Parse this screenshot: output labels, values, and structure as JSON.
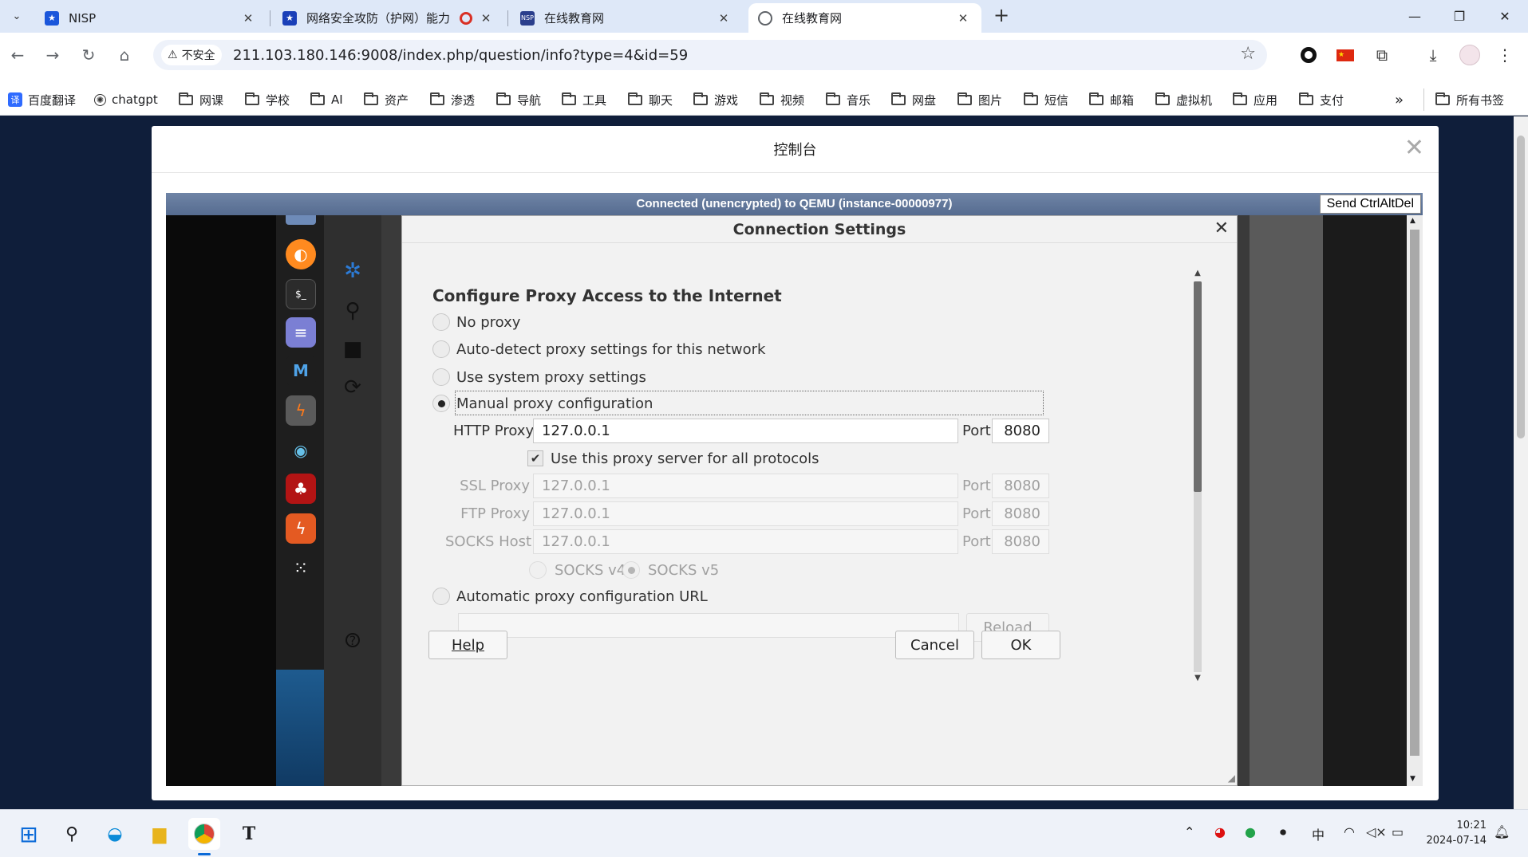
{
  "browser": {
    "tabs": [
      {
        "label": "NISP",
        "favicon_color": "#1a56db",
        "active": false
      },
      {
        "label": "网络安全攻防（护网）能力",
        "favicon_color": "#1a3fb8",
        "active": false
      },
      {
        "label": "在线教育网",
        "favicon_color": "#2a3e8c",
        "active": false
      },
      {
        "label": "在线教育网",
        "favicon_color": "#5f6368",
        "active": true
      }
    ],
    "address": {
      "security_label": "不安全",
      "url": "211.103.180.146:9008/index.php/question/info?type=4&id=59"
    },
    "bookmarks": [
      {
        "label": "百度翻译",
        "type": "link"
      },
      {
        "label": "chatgpt",
        "type": "link"
      },
      {
        "label": "网课",
        "type": "folder"
      },
      {
        "label": "学校",
        "type": "folder"
      },
      {
        "label": "AI",
        "type": "folder"
      },
      {
        "label": "资产",
        "type": "folder"
      },
      {
        "label": "渗透",
        "type": "folder"
      },
      {
        "label": "导航",
        "type": "folder"
      },
      {
        "label": "工具",
        "type": "folder"
      },
      {
        "label": "聊天",
        "type": "folder"
      },
      {
        "label": "游戏",
        "type": "folder"
      },
      {
        "label": "视频",
        "type": "folder"
      },
      {
        "label": "音乐",
        "type": "folder"
      },
      {
        "label": "网盘",
        "type": "folder"
      },
      {
        "label": "图片",
        "type": "folder"
      },
      {
        "label": "短信",
        "type": "folder"
      },
      {
        "label": "邮箱",
        "type": "folder"
      },
      {
        "label": "虚拟机",
        "type": "folder"
      },
      {
        "label": "应用",
        "type": "folder"
      },
      {
        "label": "支付",
        "type": "folder"
      }
    ],
    "bookmarks_overflow": "»",
    "all_bookmarks": "所有书签"
  },
  "console": {
    "title": "控制台",
    "vnc_status": "Connected (unencrypted) to QEMU (instance-00000977)",
    "cad_button": "Send CtrlAltDel"
  },
  "dialog": {
    "title": "Connection Settings",
    "heading": "Configure Proxy Access to the Internet",
    "options": {
      "no_proxy": "No proxy",
      "auto_detect": "Auto-detect proxy settings for this network",
      "system": "Use system proxy settings",
      "manual": "Manual proxy configuration",
      "auto_url": "Automatic proxy configuration URL"
    },
    "selected_option": "manual",
    "http_proxy": {
      "label": "HTTP Proxy",
      "value": "127.0.0.1",
      "port_label": "Port",
      "port": "8080"
    },
    "use_for_all": {
      "label": "Use this proxy server for all protocols",
      "checked": true
    },
    "ssl_proxy": {
      "label": "SSL Proxy",
      "value": "127.0.0.1",
      "port_label": "Port",
      "port": "8080"
    },
    "ftp_proxy": {
      "label": "FTP Proxy",
      "value": "127.0.0.1",
      "port_label": "Port",
      "port": "8080"
    },
    "socks_host": {
      "label": "SOCKS Host",
      "value": "127.0.0.1",
      "port_label": "Port",
      "port": "8080"
    },
    "socks_v4": "SOCKS v4",
    "socks_v5": "SOCKS v5",
    "reload": "Reload",
    "buttons": {
      "help": "Help",
      "cancel": "Cancel",
      "ok": "OK"
    }
  },
  "taskbar": {
    "time": "10:21",
    "date": "2024-07-14",
    "ime": "中"
  }
}
